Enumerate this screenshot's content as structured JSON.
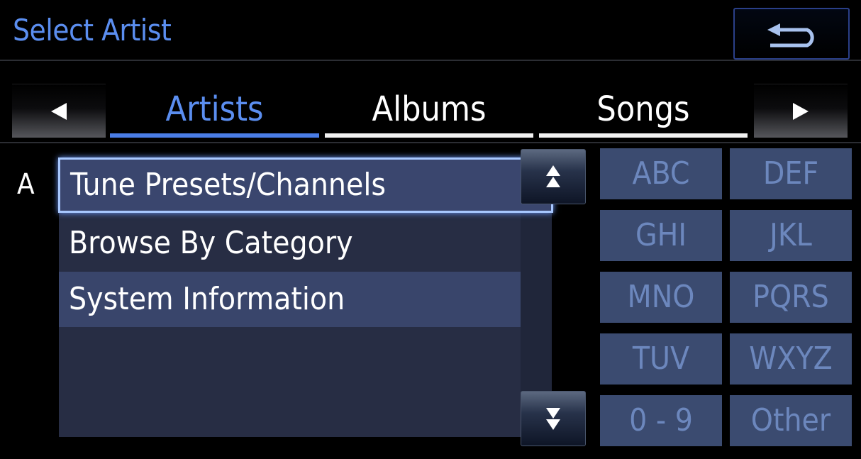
{
  "header": {
    "title": "Select Artist"
  },
  "tabs": [
    {
      "label": "Artists",
      "active": true
    },
    {
      "label": "Albums",
      "active": false
    },
    {
      "label": "Songs",
      "active": false
    }
  ],
  "list": {
    "index_letter": "A",
    "items": [
      {
        "label": "Tune Presets/Channels",
        "selected": true
      },
      {
        "label": "Browse By Category",
        "selected": false
      },
      {
        "label": "System Information",
        "selected": false
      }
    ]
  },
  "keys": [
    "ABC",
    "DEF",
    "GHI",
    "JKL",
    "MNO",
    "PQRS",
    "TUV",
    "WXYZ",
    "0 - 9",
    "Other"
  ],
  "icons": {
    "back": "return-arrow-icon",
    "tab_prev": "triangle-left-icon",
    "tab_next": "triangle-right-icon",
    "scroll_up": "double-chevron-up-icon",
    "scroll_down": "double-chevron-down-icon"
  },
  "colors": {
    "accent": "#5b8ef0",
    "active_tab_bar": "#4a7de6",
    "key_bg": "#3b4b70",
    "key_text": "#6c87bd",
    "selected_row_bg": "#3a466e",
    "selected_row_border": "#a8c8ff"
  }
}
